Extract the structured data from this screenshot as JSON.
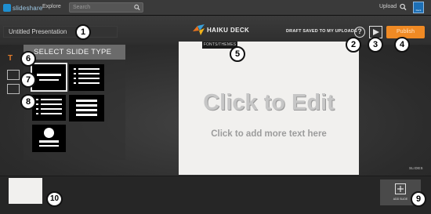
{
  "topbar": {
    "logo_text": "slideshare",
    "explore": "Explore",
    "search_placeholder": "Search",
    "upload": "Upload",
    "avatar_label": "Deck"
  },
  "header": {
    "presentation_title": "Untitled Presentation",
    "app_logo": "HAIKU DECK",
    "draft_status": "DRAFT SAVED TO MY UPLOADS",
    "help": "?",
    "publish": "Publish"
  },
  "sidebar": {
    "panel_title": "SELECT SLIDE TYPE",
    "text_tab": "T"
  },
  "slide": {
    "fonts_tab": "FONTS/THEMES",
    "title": "Click to Edit",
    "subtitle": "Click to add more text here",
    "slides_label": "SLIDES"
  },
  "bottom": {
    "add_slide": "ADD SLIDE"
  },
  "callouts": [
    "1",
    "2",
    "3",
    "4",
    "5",
    "6",
    "7",
    "8",
    "9",
    "10"
  ],
  "colors": {
    "publish": "#f08a24",
    "background": "#2a2a2a",
    "slide": "#f1f0ee"
  }
}
